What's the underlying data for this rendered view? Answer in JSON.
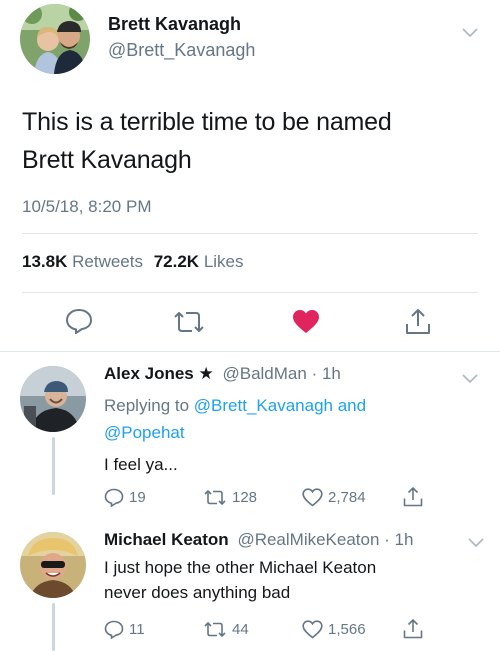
{
  "main_tweet": {
    "display_name": "Brett Kavanagh",
    "handle": "@Brett_Kavanagh",
    "text_line1": "This is a terrible time to be named",
    "text_line2": "Brett Kavanagh",
    "timestamp": "10/5/18, 8:20 PM",
    "retweets_count": "13.8K",
    "retweets_label": "Retweets",
    "likes_count": "72.2K",
    "likes_label": "Likes"
  },
  "replies": [
    {
      "display_name": "Alex Jones ★",
      "handle": "@BaldMan",
      "time": "· 1h",
      "replying_prefix": "Replying to",
      "replying_user1": "@Brett_Kavanagh",
      "replying_and": "and",
      "replying_user2": "@Popehat",
      "text": "I feel ya...",
      "reply_count": "19",
      "retweet_count": "128",
      "like_count": "2,784"
    },
    {
      "display_name": "Michael Keaton",
      "handle": "@RealMikeKeaton",
      "time": "· 1h",
      "text_line1": "I just hope the other Michael Keaton",
      "text_line2": "never does anything bad",
      "reply_count": "11",
      "retweet_count": "44",
      "like_count": "1,566"
    }
  ],
  "icons": {
    "reply": "reply-icon",
    "retweet": "retweet-icon",
    "like": "heart-icon",
    "share": "share-icon",
    "menu": "chevron-down-icon"
  },
  "colors": {
    "liked_heart": "#e0245e",
    "link_blue": "#1da1f2",
    "secondary_text": "#657786"
  }
}
